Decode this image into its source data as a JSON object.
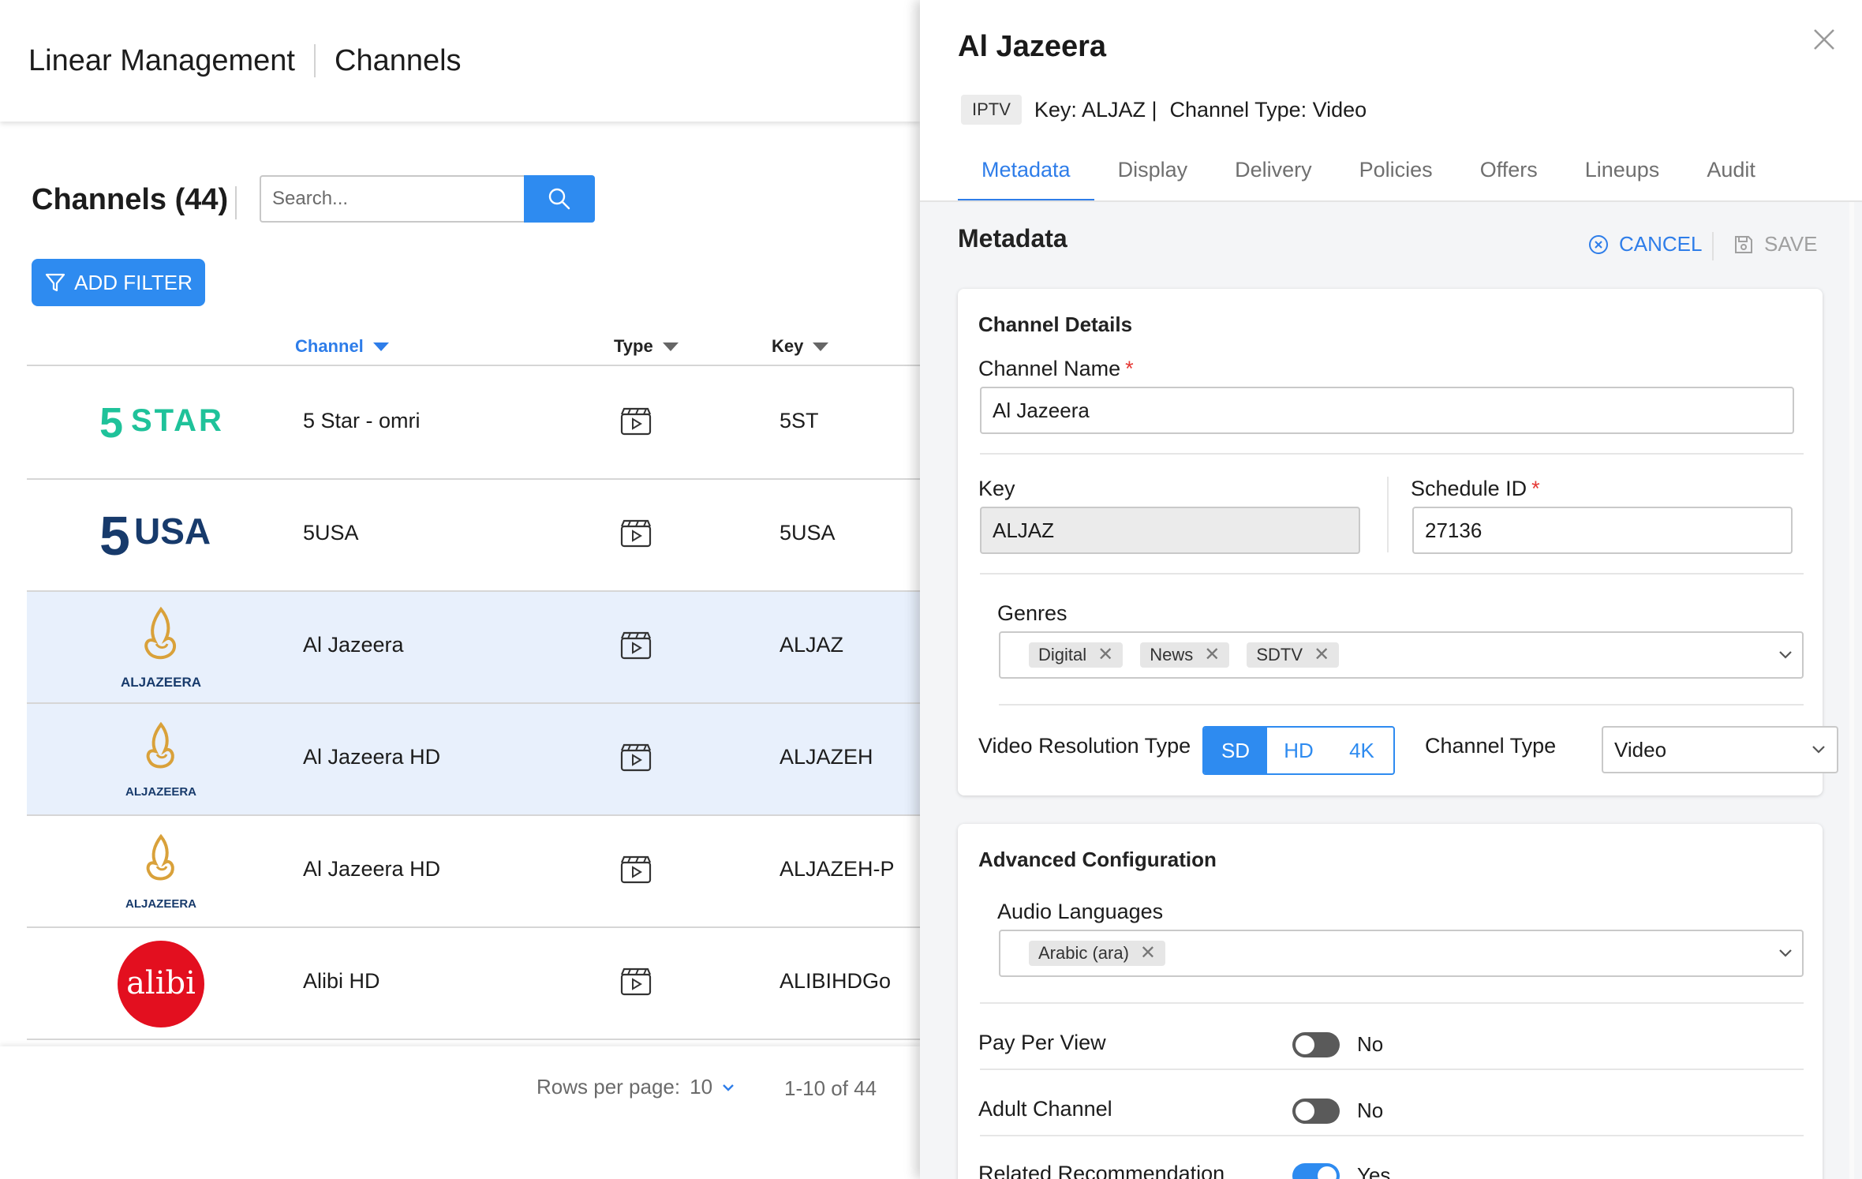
{
  "header": {
    "crumb1": "Linear Management",
    "crumb2": "Channels"
  },
  "list": {
    "title": "Channels (44)",
    "search_placeholder": "Search...",
    "add_filter_label": "ADD FILTER",
    "columns": {
      "channel": "Channel",
      "type": "Type",
      "key": "Key"
    },
    "rows": [
      {
        "logo": "5STAR",
        "name": "5 Star - omri",
        "key": "5ST",
        "selected": false
      },
      {
        "logo": "5USA",
        "name": "5USA",
        "key": "5USA",
        "selected": false
      },
      {
        "logo": "ALJAZEERA",
        "name": "Al Jazeera",
        "key": "ALJAZ",
        "selected": true
      },
      {
        "logo": "ALJAZEERA",
        "name": "Al Jazeera HD",
        "key": "ALJAZEH",
        "selected": true
      },
      {
        "logo": "ALJAZEERA",
        "name": "Al Jazeera HD",
        "key": "ALJAZEH-P",
        "selected": false
      },
      {
        "logo": "alibi",
        "name": "Alibi HD",
        "key": "ALIBIHDGo",
        "selected": false
      }
    ],
    "rows_per_page_label": "Rows per page:",
    "rows_per_page_value": "10",
    "range": "1-10 of 44"
  },
  "detail": {
    "title": "Al Jazeera",
    "badge": "IPTV",
    "key_text": "Key: ALJAZ |",
    "channel_type_text": "Channel Type: Video",
    "tabs": [
      "Metadata",
      "Display",
      "Delivery",
      "Policies",
      "Offers",
      "Lineups",
      "Audit"
    ],
    "active_tab": "Metadata",
    "section_title": "Metadata",
    "cancel_label": "CANCEL",
    "save_label": "SAVE",
    "channel_details": {
      "title": "Channel Details",
      "name_label": "Channel Name",
      "name_value": "Al Jazeera",
      "key_label": "Key",
      "key_value": "ALJAZ",
      "schedule_label": "Schedule ID",
      "schedule_value": "27136",
      "genres_label": "Genres",
      "genres": [
        "Digital",
        "News",
        "SDTV"
      ],
      "video_res_label": "Video Resolution Type",
      "video_res_options": [
        "SD",
        "HD",
        "4K"
      ],
      "video_res_selected": "SD",
      "channel_type_label": "Channel Type",
      "channel_type_value": "Video"
    },
    "advanced": {
      "title": "Advanced Configuration",
      "audio_label": "Audio Languages",
      "audio_chips": [
        "Arabic (ara)"
      ],
      "toggles": [
        {
          "label": "Pay Per View",
          "on": false,
          "value": "No"
        },
        {
          "label": "Adult Channel",
          "on": false,
          "value": "No"
        },
        {
          "label": "Related Recommendation",
          "on": true,
          "value": "Yes"
        }
      ]
    }
  },
  "colors": {
    "accent": "#2e8bf0",
    "selected_row": "#e8f0fc",
    "five_star_green": "#1fc29a",
    "five_usa_navy": "#173a6b",
    "aljazeera_gold": "#d9a13a",
    "alibi_red": "#e30f1f"
  }
}
